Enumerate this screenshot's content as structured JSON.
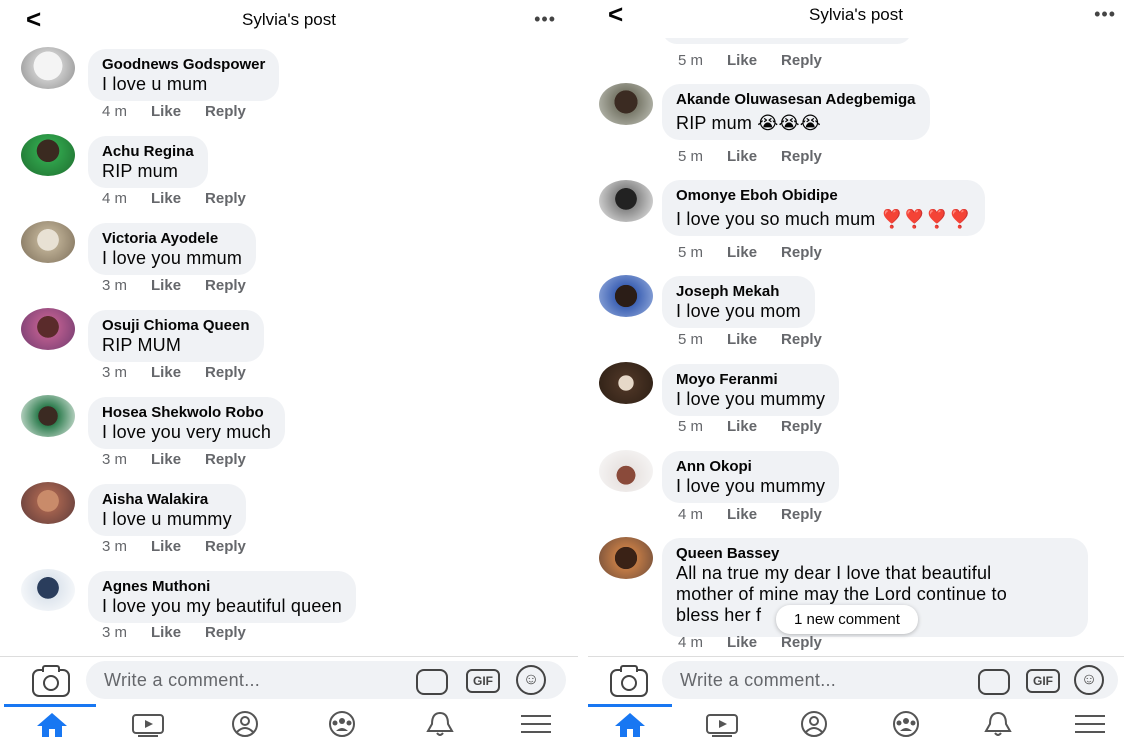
{
  "left": {
    "header": {
      "back_icon": "chevron-left-icon",
      "back_glyph": "<",
      "title": "Sylvia's post",
      "more_glyph": "•••"
    },
    "comments": [
      {
        "name": "Goodnews Godspower",
        "text": "I love u mum",
        "time": "4 m",
        "like": "Like",
        "reply": "Reply"
      },
      {
        "name": "Achu Regina",
        "text": "RIP mum",
        "time": "4 m",
        "like": "Like",
        "reply": "Reply"
      },
      {
        "name": "Victoria Ayodele",
        "text": "I love you mmum",
        "time": "3 m",
        "like": "Like",
        "reply": "Reply"
      },
      {
        "name": "Osuji Chioma Queen",
        "text": "RIP MUM",
        "time": "3 m",
        "like": "Like",
        "reply": "Reply"
      },
      {
        "name": "Hosea Shekwolo Robo",
        "text": "I love you very much",
        "time": "3 m",
        "like": "Like",
        "reply": "Reply"
      },
      {
        "name": "Aisha Walakira",
        "text": "I love u mummy",
        "time": "3 m",
        "like": "Like",
        "reply": "Reply"
      },
      {
        "name": "Agnes Muthoni",
        "text": "I love you my beautiful queen",
        "time": "3 m",
        "like": "Like",
        "reply": "Reply"
      }
    ],
    "composer": {
      "placeholder": "Write a comment...",
      "gif_label": "GIF"
    }
  },
  "right": {
    "header": {
      "back_glyph": "<",
      "title": "Sylvia's post",
      "more_glyph": "•••"
    },
    "top_meta": {
      "time": "5 m",
      "like": "Like",
      "reply": "Reply"
    },
    "comments": [
      {
        "name": "Akande Oluwasesan Adegbemiga",
        "text": "RIP mum 😭😭😭",
        "time": "5 m",
        "like": "Like",
        "reply": "Reply"
      },
      {
        "name": "Omonye Eboh Obidipe",
        "text": "I love you so much mum ❣️❣️❣️❣️",
        "time": "5 m",
        "like": "Like",
        "reply": "Reply"
      },
      {
        "name": "Joseph Mekah",
        "text": "I love you mom",
        "time": "5 m",
        "like": "Like",
        "reply": "Reply"
      },
      {
        "name": "Moyo Feranmi",
        "text": "I love you mummy",
        "time": "5 m",
        "like": "Like",
        "reply": "Reply"
      },
      {
        "name": "Ann Okopi",
        "text": "I love you mummy",
        "time": "4 m",
        "like": "Like",
        "reply": "Reply"
      },
      {
        "name": "Queen Bassey",
        "text_lines": [
          "All na true my dear I love that beautiful",
          "mother of mine may the Lord continue to",
          "bless her f"
        ],
        "time": "4 m",
        "like": "Like",
        "reply": "Reply"
      }
    ],
    "new_comment_pill": "1 new comment",
    "composer": {
      "placeholder": "Write a comment...",
      "gif_label": "GIF"
    }
  },
  "tabbar": {
    "icons": [
      "home-icon",
      "video-icon",
      "profile-icon",
      "groups-icon",
      "bell-icon",
      "menu-icon"
    ]
  },
  "colors": {
    "accent": "#1877f2",
    "bubble": "#f0f2f5",
    "meta": "#65676b"
  }
}
